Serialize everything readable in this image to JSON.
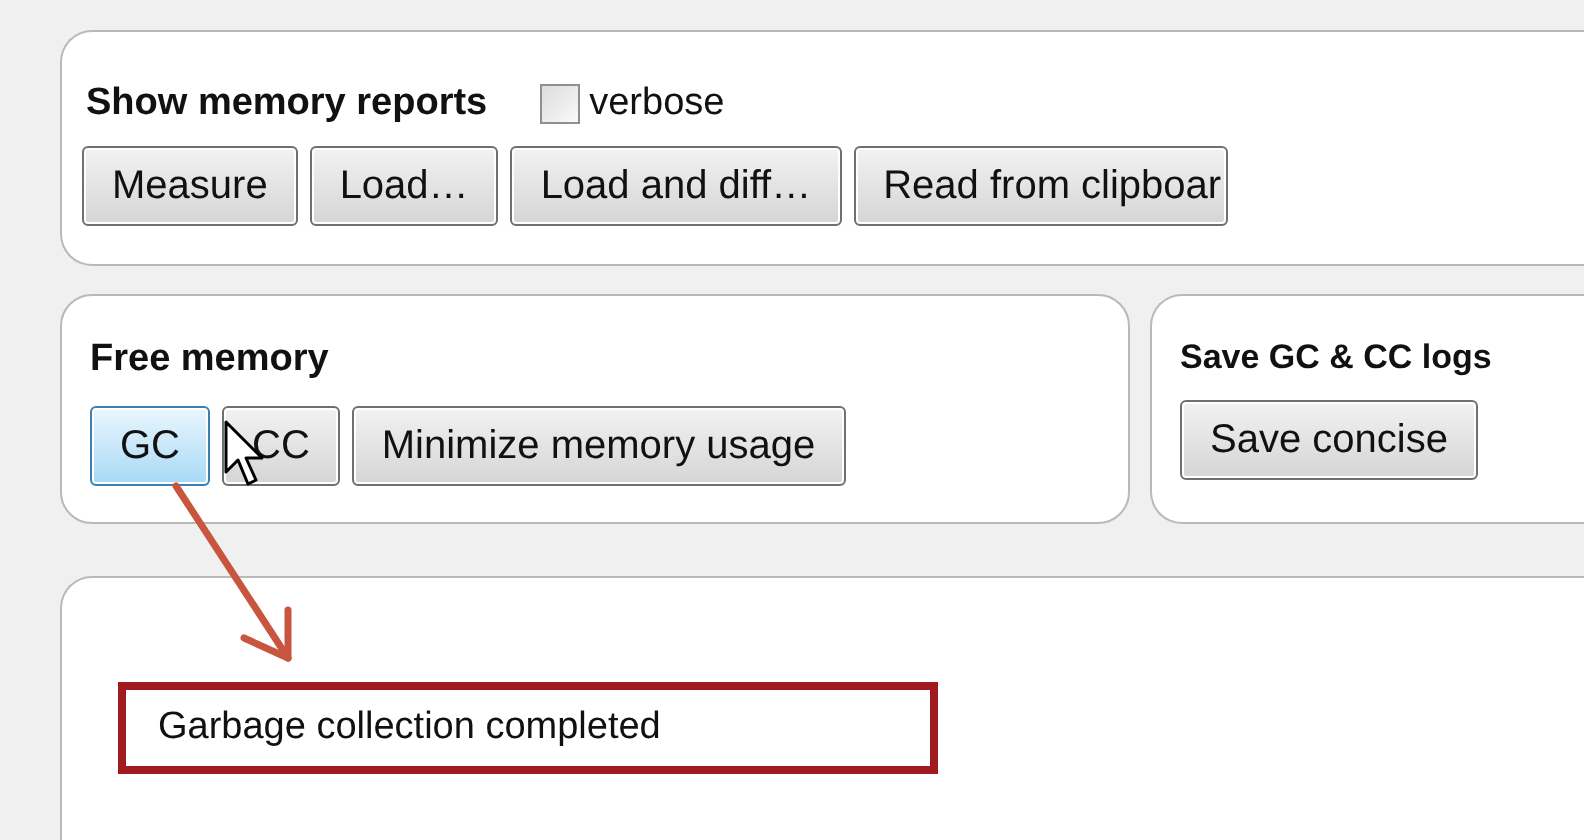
{
  "memory_reports": {
    "title": "Show memory reports",
    "verbose": {
      "label": "verbose",
      "checked": false
    },
    "buttons": [
      {
        "label": "Measure",
        "highlighted": false
      },
      {
        "label": "Load…",
        "highlighted": false
      },
      {
        "label": "Load and diff…",
        "highlighted": false
      },
      {
        "label": "Read from clipboar",
        "highlighted": false
      }
    ]
  },
  "free_memory": {
    "title": "Free memory",
    "buttons": [
      {
        "label": "GC",
        "highlighted": true
      },
      {
        "label": "CC",
        "highlighted": false
      },
      {
        "label": "Minimize memory usage",
        "highlighted": false
      }
    ]
  },
  "save_logs": {
    "title": "Save GC & CC logs",
    "buttons": [
      {
        "label": "Save concise",
        "highlighted": false
      }
    ]
  },
  "output": {
    "message": "Garbage collection completed"
  }
}
